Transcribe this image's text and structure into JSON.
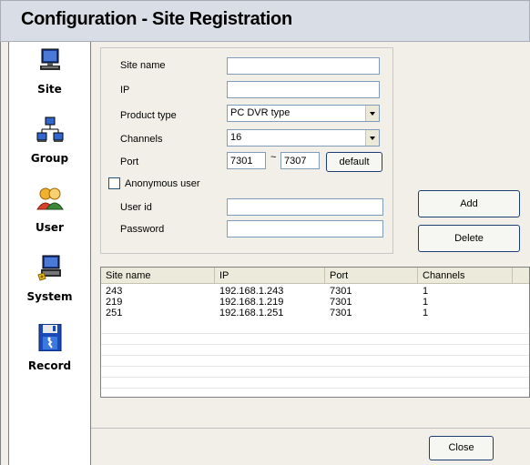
{
  "window": {
    "title": "Configuration - Site Registration"
  },
  "sidebar": {
    "items": [
      {
        "label": "Site",
        "icon": "monitor-icon"
      },
      {
        "label": "Group",
        "icon": "network-group-icon"
      },
      {
        "label": "User",
        "icon": "users-icon"
      },
      {
        "label": "System",
        "icon": "system-computer-icon"
      },
      {
        "label": "Record",
        "icon": "floppy-save-icon"
      }
    ]
  },
  "form": {
    "site_name_label": "Site name",
    "site_name_value": "",
    "ip_label": "IP",
    "ip_value": "",
    "product_type_label": "Product type",
    "product_type_value": "PC DVR type",
    "channels_label": "Channels",
    "channels_value": "16",
    "port_label": "Port",
    "port_from": "7301",
    "port_sep": "~",
    "port_to": "7307",
    "default_button": "default",
    "anonymous_label": "Anonymous user",
    "anonymous_checked": false,
    "userid_label": "User id",
    "userid_value": "",
    "password_label": "Password",
    "password_value": ""
  },
  "actions": {
    "add": "Add",
    "delete": "Delete",
    "close": "Close"
  },
  "table": {
    "headers": [
      "Site name",
      "IP",
      "Port",
      "Channels"
    ],
    "rows": [
      [
        "243",
        "192.168.1.243",
        "7301",
        "1"
      ],
      [
        "219",
        "192.168.1.219",
        "7301",
        "1"
      ],
      [
        "251",
        "192.168.1.251",
        "7301",
        "1"
      ]
    ]
  }
}
